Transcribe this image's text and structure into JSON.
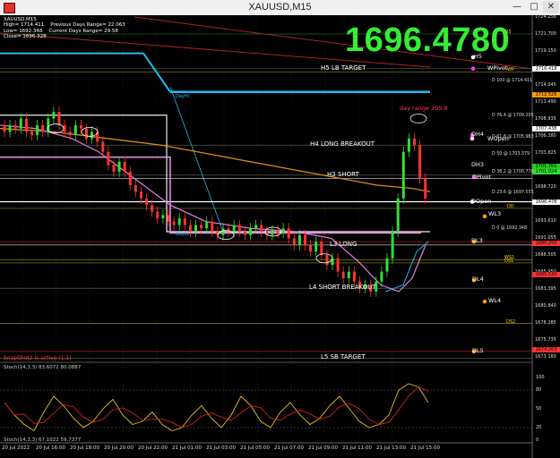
{
  "window": {
    "title": "XAUUSD,M15",
    "controls": {
      "minimize": "—",
      "maximize": "□",
      "close": "✕"
    }
  },
  "info_panel": {
    "symbol": "XAUUSD,M15",
    "rows": [
      {
        "label": "High= 1714.411",
        "value": "Previous Days Range= 22.063"
      },
      {
        "label": "Low= 1692.348",
        "value": "Current Days Range= 29.58"
      },
      {
        "label": "Close= 1696.328",
        "value": ""
      }
    ]
  },
  "big_price": "1696.4780",
  "day_range_text": "day range 295.8",
  "snapshot_notice": "SnapShot2 is active (1,1)",
  "stoch_label": "Stoch(14,3,3) 83.6072 80.0887",
  "stoch_label2": "Stoch(14,3,3) 67.1022 59.7377",
  "levels": [
    {
      "name": "R5",
      "text": "R5",
      "price": 1721.7,
      "color": "#ffd700"
    },
    {
      "name": "H5",
      "text": "H5",
      "price": 1718.2,
      "color": "#ffffff"
    },
    {
      "name": "H5 LB TARGET",
      "text": "H5 LB TARGET",
      "price": 1716.5,
      "color": "#ffffff"
    },
    {
      "name": "WP",
      "text": "WP",
      "price": 1716.0,
      "color": "#ffd700"
    },
    {
      "name": "WPivot",
      "text": "WPivot",
      "price": 1716.5,
      "color": "#ffffff"
    },
    {
      "name": "H4 LONG BREAKOUT",
      "text": "H4 LONG BREAKOUT",
      "price": 1705.0,
      "color": "#ffffff"
    },
    {
      "name": "DH4",
      "text": "DH4",
      "price": 1706.5,
      "color": "#ffffff"
    },
    {
      "name": "WOpen",
      "text": "WOpen",
      "price": 1705.8,
      "color": "#ffffff"
    },
    {
      "name": "H3 SHORT",
      "text": "H3 SHORT",
      "price": 1700.5,
      "color": "#ffffff"
    },
    {
      "name": "DH3",
      "text": "DH3",
      "price": 1702.0,
      "color": "#ffffff"
    },
    {
      "name": "DPivot",
      "text": "DPivot",
      "price": 1700.0,
      "color": "#ffffff"
    },
    {
      "name": "DOpen",
      "text": "DOpen",
      "price": 1696.5,
      "color": "#ffffff"
    },
    {
      "name": "WL3",
      "text": "WL3",
      "price": 1694.5,
      "color": "#ffffff"
    },
    {
      "name": "DD",
      "text": "DD",
      "price": 1695.5,
      "color": "#ffd700"
    },
    {
      "name": "L3 LONG",
      "text": "L3 LONG",
      "price": 1690.0,
      "color": "#ffffff"
    },
    {
      "name": "DL3",
      "text": "DL3",
      "price": 1690.5,
      "color": "#ffffff"
    },
    {
      "name": "WS1",
      "text": "WS1",
      "price": 1687.8,
      "color": "#ffd700"
    },
    {
      "name": "DS1",
      "text": "DS1",
      "price": 1687.3,
      "color": "#ffd700"
    },
    {
      "name": "L4 SHORT BREAKOUT",
      "text": "L4 SHORT BREAKOUT",
      "price": 1683.5,
      "color": "#ffffff"
    },
    {
      "name": "DL4",
      "text": "DL4",
      "price": 1684.8,
      "color": "#ffffff"
    },
    {
      "name": "WL4",
      "text": "WL4",
      "price": 1681.5,
      "color": "#ffffff"
    },
    {
      "name": "DS2",
      "text": "DS2",
      "price": 1678.2,
      "color": "#ffd700"
    },
    {
      "name": "DL5",
      "text": "DL5",
      "price": 1674.0,
      "color": "#ffffff"
    },
    {
      "name": "L5 SB TARGET",
      "text": "L5 SB TARGET",
      "price": 1673.0,
      "color": "#ffffff"
    }
  ],
  "fib_labels": [
    {
      "text": "D 100 @ 1714.411",
      "price": 1714.4
    },
    {
      "text": "D 76.4 @ 1709.205",
      "price": 1709.2
    },
    {
      "text": "D 61.8 @ 1705.983",
      "price": 1706.0
    },
    {
      "text": "D 50 @ 1703.379",
      "price": 1703.4
    },
    {
      "text": "D 38.2 @ 1700.776",
      "price": 1700.8
    },
    {
      "text": "D 23.6 @ 1697.555",
      "price": 1697.6
    },
    {
      "text": "D 0 @ 1692.348",
      "price": 1692.3
    }
  ],
  "day_markers": [
    {
      "text": "DayHi",
      "price": 1713.0
    },
    {
      "text": "DayLo",
      "price": 1691.8
    }
  ],
  "price_axis": [
    "1724.256",
    "1721.700",
    "1719.150",
    "1716.595",
    "1714.045",
    "1711.490",
    "1708.935",
    "1706.380",
    "1703.825",
    "1701.275",
    "1698.720",
    "1696.165",
    "1693.610",
    "1691.055",
    "1688.505",
    "1685.950",
    "1683.395",
    "1680.840",
    "1678.285",
    "1675.735",
    "1673.180"
  ],
  "price_tags": [
    {
      "text": "1716.418",
      "price": 1716.4,
      "color": "#ffffff"
    },
    {
      "text": "1712.526",
      "price": 1712.5,
      "color": "#ff9900"
    },
    {
      "text": "1707.438",
      "price": 1707.4,
      "color": "#ffffff"
    },
    {
      "text": "1701.765",
      "price": 1701.8,
      "color": "#22cc22"
    },
    {
      "text": "1701.024",
      "price": 1701.0,
      "color": "#33dd33"
    },
    {
      "text": "1696.478",
      "price": 1696.5,
      "color": "#ffffff"
    },
    {
      "text": "1690.250",
      "price": 1690.2,
      "color": "#ff3333"
    },
    {
      "text": "1685.530",
      "price": 1685.5,
      "color": "#ff3333"
    },
    {
      "text": "1674.263",
      "price": 1674.3,
      "color": "#ff3333"
    }
  ],
  "stoch_axis": [
    "100",
    "80",
    "50",
    "20",
    "0"
  ],
  "time_axis": [
    "20 Jul 2022",
    "20 Jul 16:00",
    "20 Jul 18:00",
    "20 Jul 20:00",
    "20 Jul 22:00",
    "21 Jul 01:00",
    "21 Jul 03:00",
    "21 Jul 05:00",
    "21 Jul 07:00",
    "21 Jul 09:00",
    "21 Jul 11:00",
    "21 Jul 13:00",
    "21 Jul 15:00"
  ],
  "colors": {
    "bull": "#33dd33",
    "bear": "#ff3333",
    "ma_orange": "#d98c1a",
    "ma_pink": "#e27fe2",
    "cyan": "#22bbee",
    "grid": "#1e1e1e"
  }
}
